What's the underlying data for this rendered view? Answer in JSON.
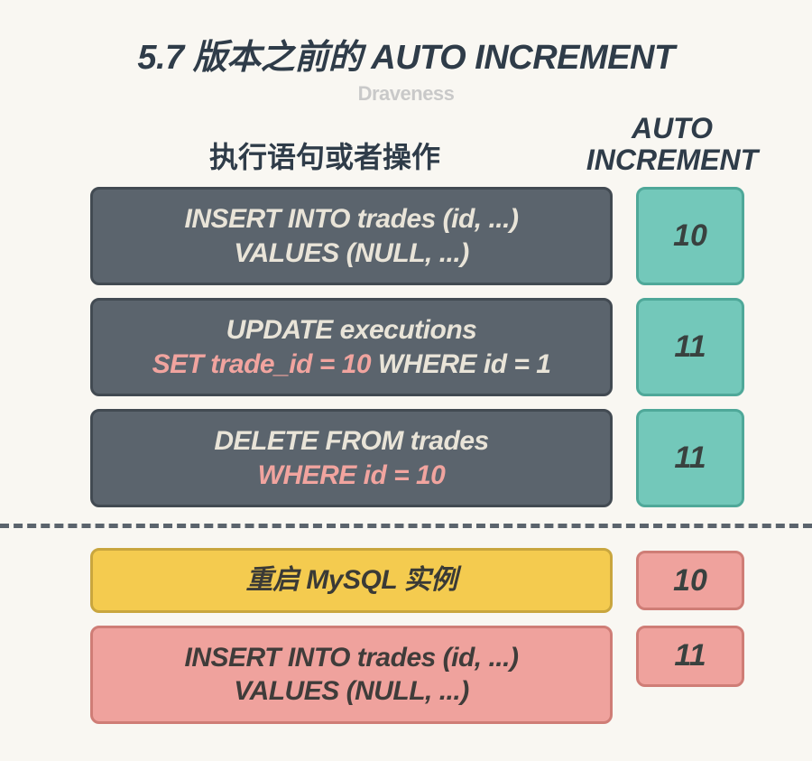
{
  "title": "5.7 版本之前的 AUTO INCREMENT",
  "subtitle": "Draveness",
  "columns": {
    "statement": "执行语句或者操作",
    "auto_increment_line1": "AUTO",
    "auto_increment_line2": "INCREMENT"
  },
  "rows": [
    {
      "statement_line1": "INSERT INTO trades (id, ...)",
      "statement_line2": "VALUES (NULL, ...)",
      "style": "dark",
      "value": "10",
      "value_style": "teal"
    },
    {
      "statement_pre": "UPDATE executions",
      "statement_highlight": "SET trade_id = 10",
      "statement_post": " WHERE id = 1",
      "style": "dark",
      "value": "11",
      "value_style": "teal"
    },
    {
      "statement_line1": "DELETE FROM trades",
      "statement_highlight2": "WHERE id = 10",
      "style": "dark",
      "value": "11",
      "value_style": "teal"
    }
  ],
  "rows_after": [
    {
      "statement_line1": "重启 MySQL 实例",
      "style": "yellow",
      "value": "10",
      "value_style": "pink"
    },
    {
      "statement_line1": "INSERT INTO trades (id, ...)",
      "statement_line2": "VALUES (NULL, ...)",
      "style": "pink",
      "value": "11",
      "value_style": "pink"
    }
  ]
}
